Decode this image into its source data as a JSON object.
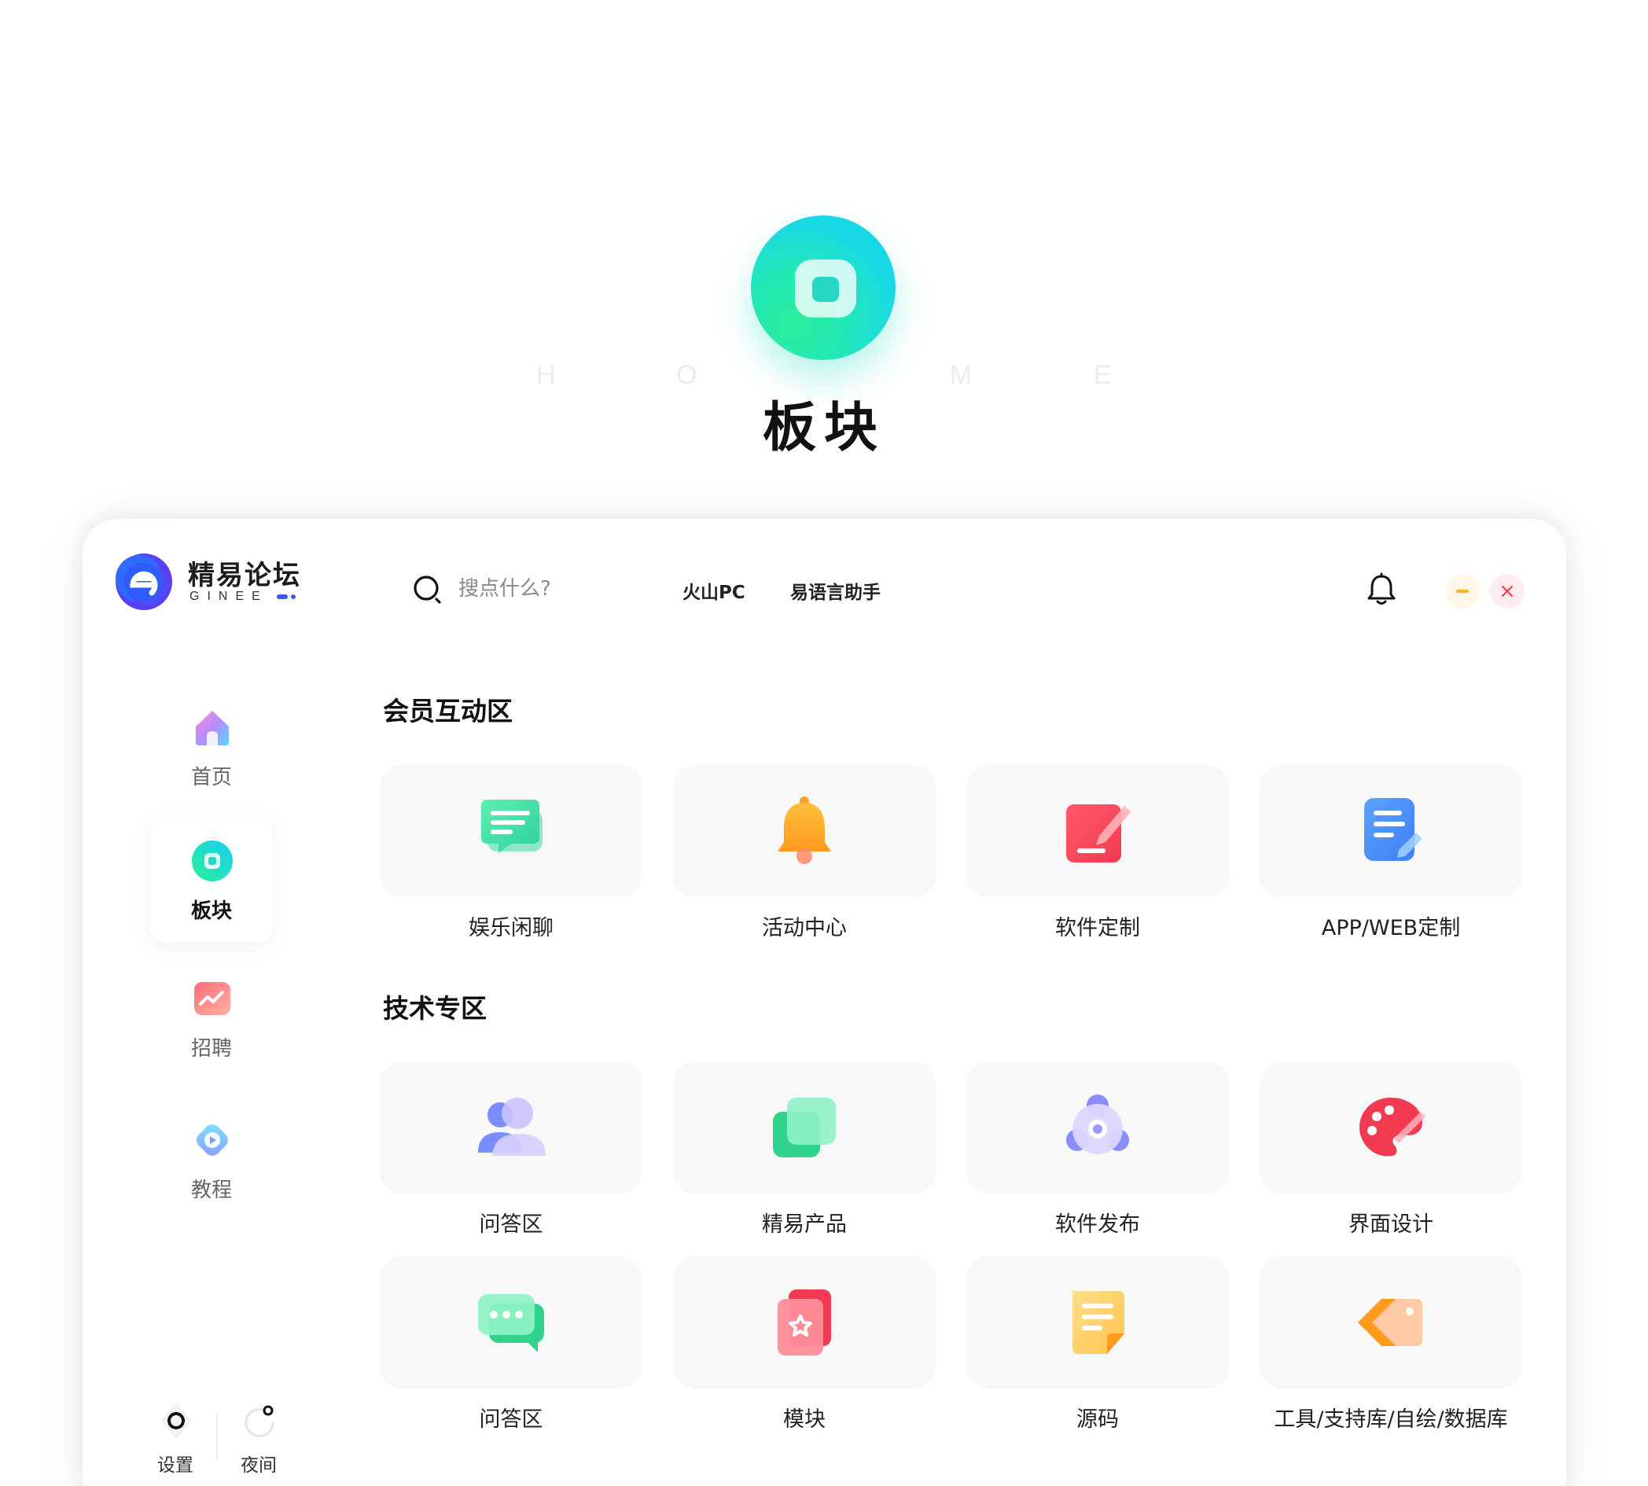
{
  "hero": {
    "letters": [
      "H",
      "O",
      "M",
      "E"
    ],
    "title": "板块"
  },
  "brand": {
    "name": "精易论坛",
    "sub": "GINEE"
  },
  "header": {
    "search_placeholder": "搜点什么?",
    "nav": [
      "火山PC",
      "易语言助手"
    ],
    "minimize_icon": "minimize-icon",
    "close_icon": "×"
  },
  "sidebar": {
    "items": [
      {
        "label": "首页",
        "icon": "home-icon",
        "active": false
      },
      {
        "label": "板块",
        "icon": "board-icon",
        "active": true
      },
      {
        "label": "招聘",
        "icon": "recruit-icon",
        "active": false
      },
      {
        "label": "教程",
        "icon": "tutorial-icon",
        "active": false
      }
    ],
    "footer": [
      {
        "label": "设置",
        "icon": "settings-icon"
      },
      {
        "label": "夜间",
        "icon": "night-mode-icon"
      }
    ]
  },
  "sections": [
    {
      "title": "会员互动区",
      "cards": [
        {
          "label": "娱乐闲聊",
          "icon": "chat-icon"
        },
        {
          "label": "活动中心",
          "icon": "bell-icon"
        },
        {
          "label": "软件定制",
          "icon": "edit-icon"
        },
        {
          "label": "APP/WEB定制",
          "icon": "document-icon"
        }
      ]
    },
    {
      "title": "技术专区",
      "cards": [
        {
          "label": "问答区",
          "icon": "users-icon"
        },
        {
          "label": "精易产品",
          "icon": "layers-icon"
        },
        {
          "label": "软件发布",
          "icon": "disc-icon"
        },
        {
          "label": "界面设计",
          "icon": "palette-icon"
        },
        {
          "label": "问答区",
          "icon": "message-icon"
        },
        {
          "label": "模块",
          "icon": "module-icon"
        },
        {
          "label": "源码",
          "icon": "source-code-icon"
        },
        {
          "label": "工具/支持库/自绘/数据库",
          "icon": "tag-icon"
        }
      ]
    }
  ],
  "colors": {
    "accent_teal": "#1fe0c2",
    "brand_blue": "#3a58f2",
    "close_red": "#ff3b4f",
    "minimize_yellow": "#ffb21a"
  }
}
